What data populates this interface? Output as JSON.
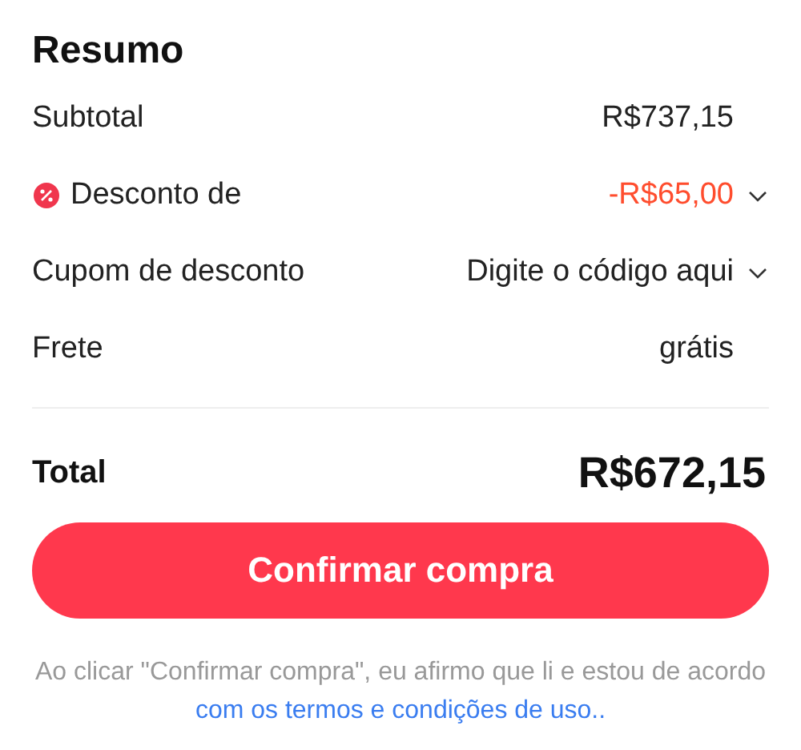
{
  "title": "Resumo",
  "rows": [
    {
      "kind": "plain",
      "label": "Subtotal",
      "value": "R$737,15"
    },
    {
      "kind": "discount",
      "label": "Desconto de",
      "value": "-R$65,00",
      "expanded": false
    },
    {
      "kind": "coupon",
      "label": "Cupom de desconto",
      "value": "Digite o código aqui",
      "expanded": false
    },
    {
      "kind": "plain",
      "label": "Frete",
      "value": "grátis"
    }
  ],
  "total": {
    "label": "Total",
    "value": "R$672,15"
  },
  "button": "Confirmar compra",
  "notice": {
    "text": "Ao clicar \"Confirmar compra\", eu afirmo que li e estou de acordo",
    "link": "com os termos e condições de uso.."
  }
}
